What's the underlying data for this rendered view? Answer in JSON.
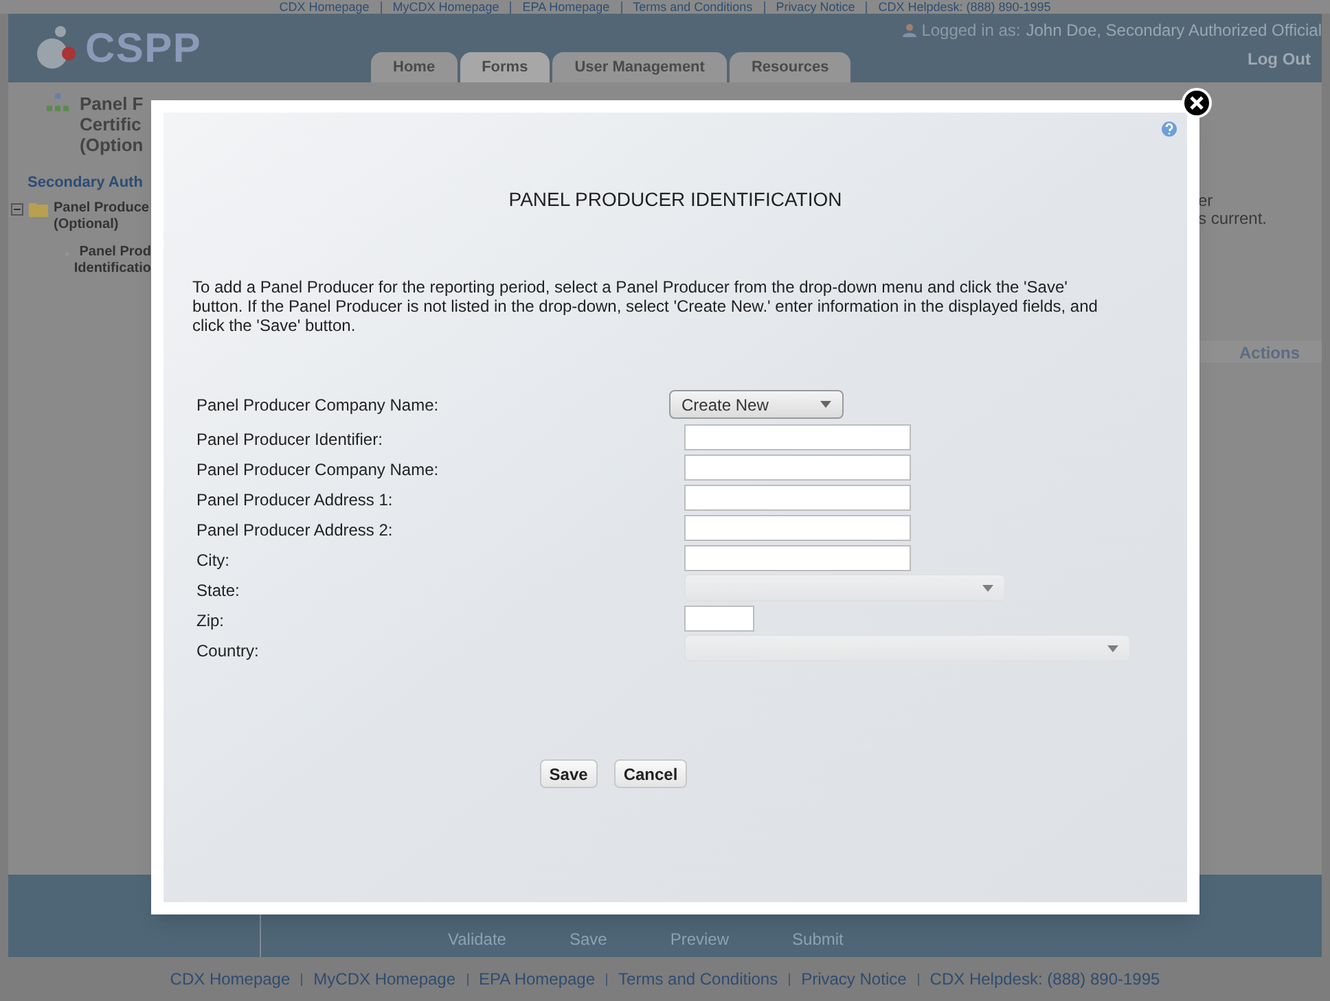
{
  "top_links": [
    "CDX Homepage",
    "MyCDX Homepage",
    "EPA Homepage",
    "Terms and Conditions",
    "Privacy Notice",
    "CDX Helpdesk: (888) 890-1995"
  ],
  "header": {
    "logo": "CSPP",
    "logged_in_label": "Logged in as:",
    "user": "John Doe, Secondary Authorized Official",
    "logout": "Log Out",
    "tabs": [
      {
        "label": "Home",
        "selected": false
      },
      {
        "label": "Forms",
        "selected": true
      },
      {
        "label": "User Management",
        "selected": false
      },
      {
        "label": "Resources",
        "selected": false
      }
    ]
  },
  "sidebar": {
    "title_lines": [
      "Panel F",
      "Certific",
      "(Option"
    ],
    "section": "Secondary Auth",
    "tree": [
      {
        "label": "Panel Produce",
        "sub": "(Optional)",
        "expanded": true,
        "children": [
          {
            "label": "Panel Prod",
            "sub": "Identificatio"
          }
        ]
      }
    ]
  },
  "content_right": {
    "lines": [
      "er",
      "s current."
    ],
    "column_heading": "Actions"
  },
  "toolbar": [
    "Validate",
    "Save",
    "Preview",
    "Submit"
  ],
  "modal": {
    "title": "PANEL PRODUCER IDENTIFICATION",
    "instructions": "To add a Panel Producer for the reporting period, select a Panel Producer from the drop-down menu and click the 'Save' button. If the Panel Producer is not listed in the drop-down, select 'Create New.' enter information in the displayed fields, and click the 'Save' button.",
    "fields": [
      {
        "label": "Panel Producer Company Name:",
        "kind": "dropdown",
        "value": "Create New"
      },
      {
        "label": "Panel Producer Identifier:",
        "kind": "text"
      },
      {
        "label": "Panel Producer Company Name:",
        "kind": "text"
      },
      {
        "label": "Panel Producer Address 1:",
        "kind": "text"
      },
      {
        "label": "Panel Producer Address 2:",
        "kind": "text"
      },
      {
        "label": "City:",
        "kind": "text"
      },
      {
        "label": "State:",
        "kind": "select"
      },
      {
        "label": "Zip:",
        "kind": "short"
      },
      {
        "label": "Country:",
        "kind": "wide_select"
      }
    ],
    "buttons": [
      "Save",
      "Cancel"
    ]
  },
  "footer_links": [
    "CDX Homepage",
    "MyCDX Homepage",
    "EPA Homepage",
    "Terms and Conditions",
    "Privacy Notice",
    "CDX Helpdesk: (888) 890-1995"
  ]
}
